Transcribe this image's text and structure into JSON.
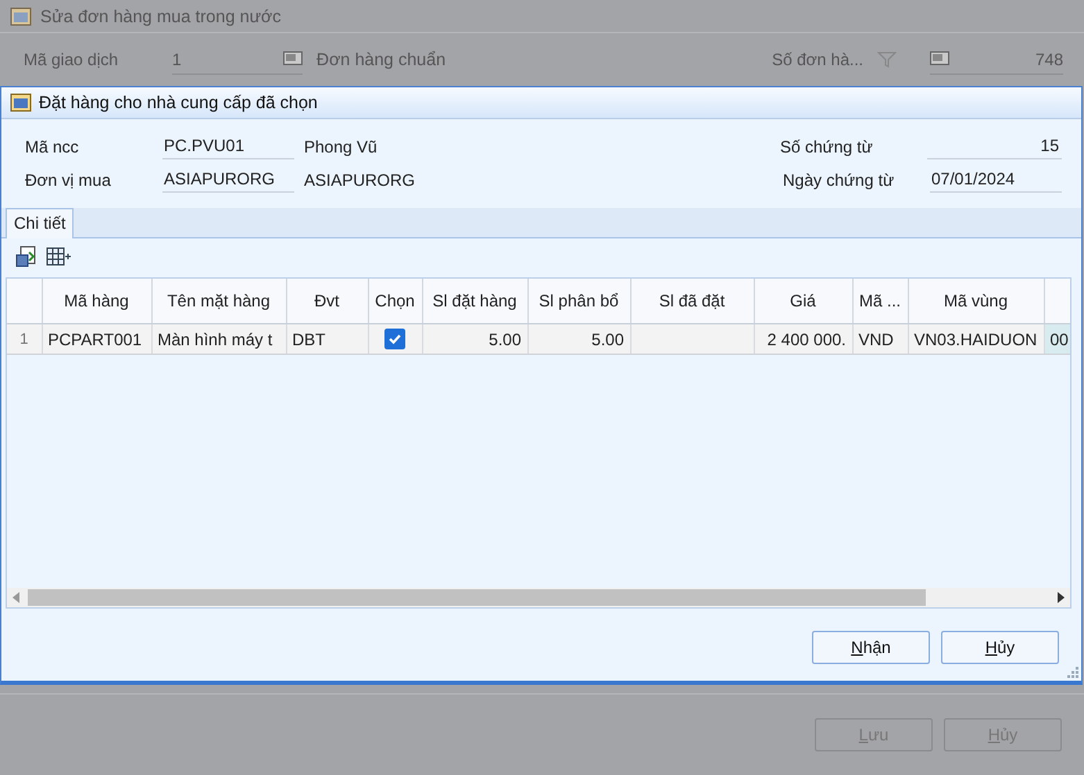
{
  "background_window": {
    "title": "Sửa đơn hàng mua trong nước",
    "fields": {
      "transaction_label": "Mã giao dịch",
      "transaction_value": "1",
      "standard_order_label": "Đơn hàng chuẩn",
      "order_number_label": "Số đơn hà...",
      "order_number_value": "748"
    },
    "buttons": [
      {
        "label": "Lưu",
        "disabled": true
      },
      {
        "label": "Hủy",
        "disabled": true
      }
    ]
  },
  "dialog": {
    "title": "Đặt hàng cho nhà cung cấp đã chọn",
    "form": {
      "supplier_label": "Mã ncc",
      "supplier_code": "PC.PVU01",
      "supplier_name": "Phong Vũ",
      "buyer_label": "Đơn vị mua",
      "buyer_code": "ASIAPURORG",
      "buyer_name": "ASIAPURORG",
      "voucher_no_label": "Số chứng từ",
      "voucher_no": "15",
      "voucher_date_label": "Ngày chứng từ",
      "voucher_date": "07/01/2024"
    },
    "tabs": [
      {
        "label": "Chi tiết",
        "selected": true
      }
    ],
    "table": {
      "columns": [
        "",
        "Mã hàng",
        "Tên mặt hàng",
        "Đvt",
        "Chọn",
        "Sl đặt hàng",
        "Sl phân bổ",
        "Sl đã đặt",
        "Giá",
        "Mã ...",
        "Mã vùng",
        ""
      ],
      "rows": [
        {
          "row_number": "1",
          "item_code": "PCPART001",
          "item_name": "Màn hình máy t",
          "unit": "DBT",
          "checked": true,
          "order_qty": "5.00",
          "allocated_qty": "5.00",
          "ordered_qty": "",
          "price": "2 400 000.",
          "currency": "VND",
          "region": "VN03.HAIDUON",
          "column_12": "00"
        }
      ]
    },
    "buttons": [
      {
        "label": "Nhận",
        "disabled": false
      },
      {
        "label": "Hủy",
        "disabled": false
      }
    ]
  }
}
